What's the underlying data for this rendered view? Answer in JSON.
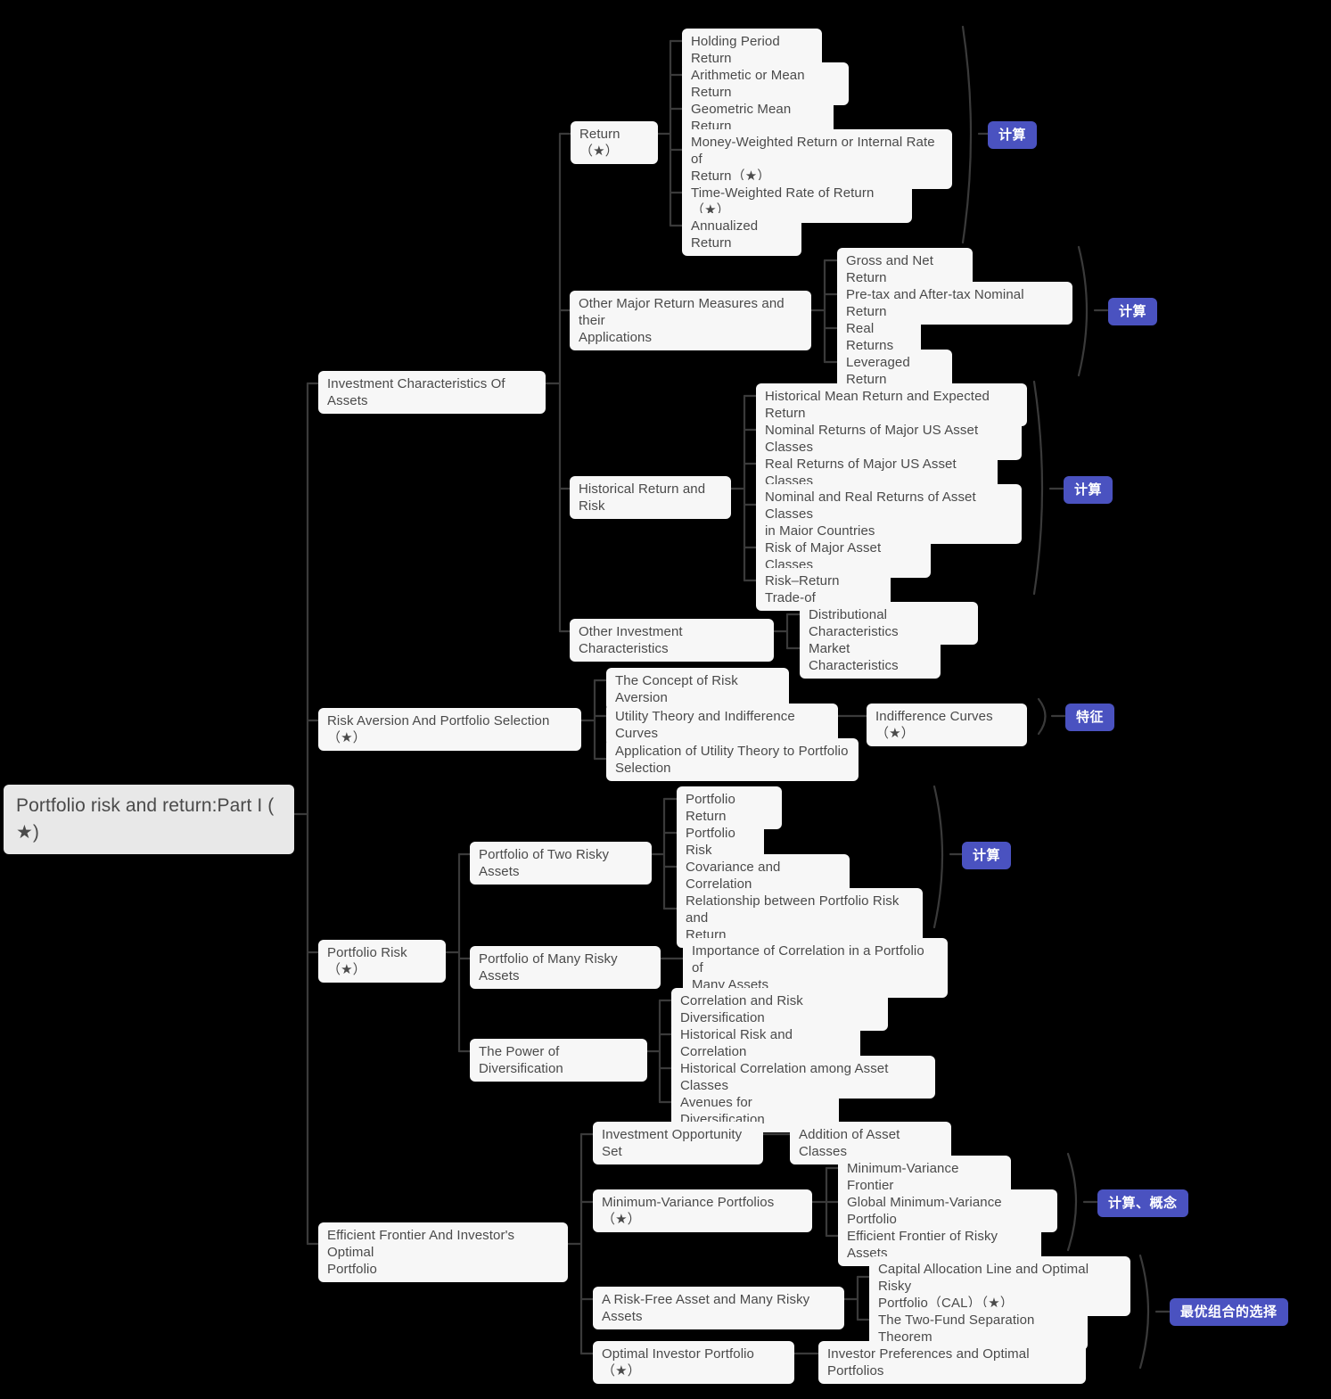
{
  "diagram": {
    "type": "mind-map",
    "title": "Portfolio risk and return:Part I (★)",
    "background_color": "#000000",
    "node_color": "#f7f7f7",
    "root_color": "#e8e8e8",
    "badge_color": "#4a52c0",
    "text_color": "#4a4a4a"
  },
  "root": {
    "label": "Portfolio risk and return:Part I (\n★)"
  },
  "branches": {
    "b1": {
      "label": "Investment Characteristics Of Assets"
    },
    "b2": {
      "label": "Risk Aversion And Portfolio Selection（★）"
    },
    "b3": {
      "label": "Portfolio Risk（★）"
    },
    "b4": {
      "label": "Efficient Frontier And Investor's Optimal\nPortfolio"
    }
  },
  "nodes": {
    "return": {
      "label": "Return（★）"
    },
    "holding_period_return": {
      "label": "Holding Period Return"
    },
    "arithmetic_mean_return": {
      "label": "Arithmetic or Mean Return"
    },
    "geometric_mean_return": {
      "label": "Geometric Mean Return"
    },
    "money_weighted_return": {
      "label": "Money-Weighted Return or Internal Rate of\nReturn（★）"
    },
    "time_weighted_rate": {
      "label": "Time-Weighted Rate of Return（★）"
    },
    "annualized_return": {
      "label": "Annualized Return"
    },
    "other_major_return_measures": {
      "label": "Other Major Return Measures and their\nApplications"
    },
    "gross_and_net_return": {
      "label": "Gross and Net Return"
    },
    "pretax_aftertax_nominal_return": {
      "label": "Pre-tax and After-tax Nominal Return"
    },
    "real_returns": {
      "label": "Real Returns"
    },
    "leveraged_return": {
      "label": "Leveraged Return"
    },
    "historical_return_and_risk": {
      "label": "Historical Return and Risk"
    },
    "historical_mean_expected": {
      "label": "Historical Mean Return and Expected Return"
    },
    "nominal_returns_us": {
      "label": "Nominal Returns of Major US Asset Classes"
    },
    "real_returns_us": {
      "label": "Real Returns of Major US Asset Classes"
    },
    "nominal_real_major_countries": {
      "label": "Nominal and Real Returns of Asset Classes\nin Major Countries"
    },
    "risk_major_asset_classes": {
      "label": "Risk of Major Asset Classes"
    },
    "risk_return_tradeoff": {
      "label": "Risk–Return Trade-of"
    },
    "other_investment_characteristics": {
      "label": "Other Investment Characteristics"
    },
    "distributional_characteristics": {
      "label": "Distributional Characteristics"
    },
    "market_characteristics": {
      "label": "Market Characteristics"
    },
    "concept_risk_aversion": {
      "label": "The Concept of Risk Aversion"
    },
    "utility_theory_indifference": {
      "label": "Utility Theory and Indifference Curves"
    },
    "indifference_curves": {
      "label": "Indifference Curves（★）"
    },
    "application_utility_theory": {
      "label": "Application of Utility Theory to Portfolio\nSelection"
    },
    "portfolio_two_risky_assets": {
      "label": "Portfolio of Two Risky Assets"
    },
    "portfolio_return": {
      "label": "Portfolio Return"
    },
    "portfolio_risk_sub": {
      "label": "Portfolio Risk"
    },
    "covariance_correlation": {
      "label": "Covariance and Correlation"
    },
    "relationship_risk_return": {
      "label": "Relationship between Portfolio Risk and\nReturn"
    },
    "portfolio_many_risky_assets": {
      "label": "Portfolio of Many Risky Assets"
    },
    "importance_of_correlation": {
      "label": "Importance of Correlation in a Portfolio of\nMany Assets"
    },
    "power_of_diversification": {
      "label": "The Power of Diversification"
    },
    "correlation_risk_diversification": {
      "label": "Correlation and Risk Diversification"
    },
    "historical_risk_correlation": {
      "label": "Historical Risk and Correlation"
    },
    "historical_correlation_asset_classes": {
      "label": "Historical Correlation among Asset Classes"
    },
    "avenues_for_diversification": {
      "label": "Avenues for Diversification"
    },
    "investment_opportunity_set": {
      "label": "Investment Opportunity Set"
    },
    "addition_of_asset_classes": {
      "label": "Addition of Asset Classes"
    },
    "minimum_variance_portfolios": {
      "label": "Minimum-Variance Portfolios（★）"
    },
    "minimum_variance_frontier": {
      "label": "Minimum-Variance Frontier"
    },
    "global_minimum_variance_portfolio": {
      "label": "Global Minimum-Variance Portfolio"
    },
    "efficient_frontier_risky_assets": {
      "label": "Efficient Frontier of Risky Assets"
    },
    "risk_free_many_risky": {
      "label": "A Risk-Free Asset and Many Risky Assets"
    },
    "capital_allocation_line": {
      "label": "Capital Allocation Line and Optimal Risky\nPortfolio（CAL）（★）"
    },
    "two_fund_separation": {
      "label": "The Two-Fund Separation Theorem"
    },
    "optimal_investor_portfolio": {
      "label": "Optimal Investor Portfolio（★）"
    },
    "investor_preferences": {
      "label": "Investor Preferences and Optimal Portfolios"
    }
  },
  "badges": {
    "badge_return": {
      "label": "计算"
    },
    "badge_other_measures": {
      "label": "计算"
    },
    "badge_historical": {
      "label": "计算"
    },
    "badge_risk_aversion": {
      "label": "特征"
    },
    "badge_portfolio_two": {
      "label": "计算"
    },
    "badge_min_variance": {
      "label": "计算、概念"
    },
    "badge_optimal_combo": {
      "label": "最优组合的选择"
    }
  }
}
